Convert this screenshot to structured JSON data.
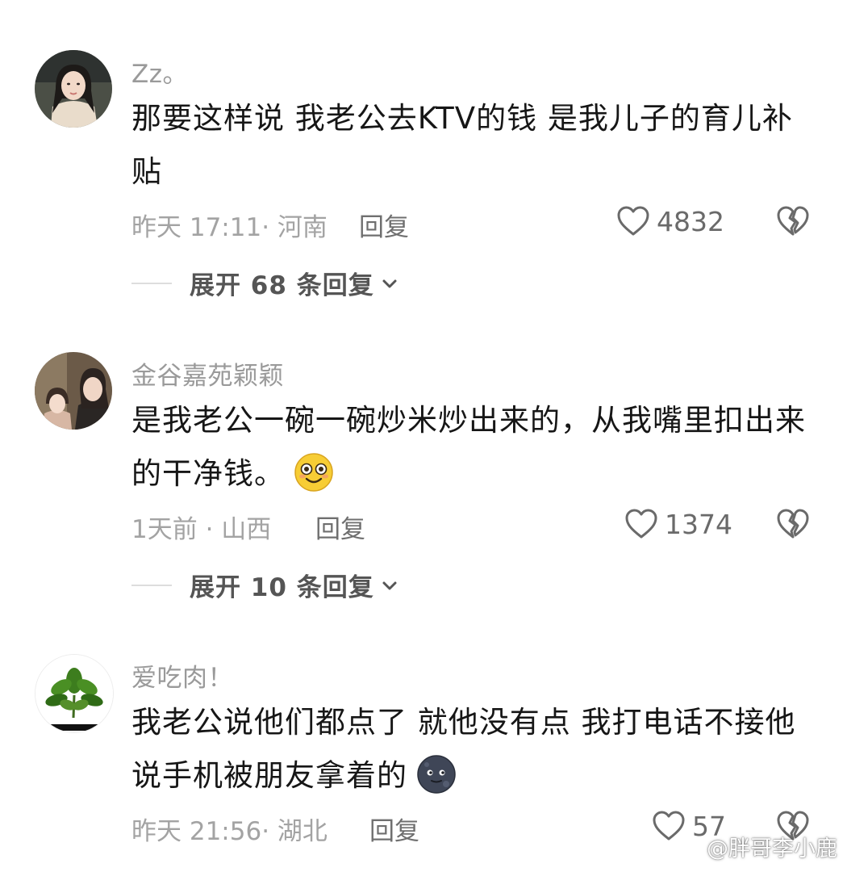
{
  "comments": [
    {
      "username": "Zz。",
      "text": "那要这样说 我老公去KTV的钱  是我儿子的育儿补贴",
      "time": "昨天 17:11",
      "location": "· 河南",
      "reply_label": "回复",
      "likes": "4832",
      "expand_label": "展开 68 条回复",
      "avatar_icon": "woman-portrait",
      "emoji_icon": null
    },
    {
      "username": "金谷嘉苑颖颖",
      "text": "是我老公一碗一碗炒米炒出来的，从我嘴里扣出来的干净钱。",
      "time": "1天前",
      "location": " · 山西",
      "reply_label": "回复",
      "likes": "1374",
      "expand_label": "展开 10 条回复",
      "avatar_icon": "mother-child-portrait",
      "emoji_icon": "smiling-face-emoji"
    },
    {
      "username": "爱吃肉！",
      "text": "我老公说他们都点了 就他没有点  我打电话不接他说手机被朋友拿着的",
      "time": "昨天 21:56",
      "location": "· 湖北",
      "reply_label": "回复",
      "likes": "57",
      "avatar_icon": "plant",
      "emoji_icon": "new-moon-face-emoji"
    }
  ],
  "watermark": {
    "text": "@胖哥李小鹿",
    "icon": "weibo-logo"
  },
  "colors": {
    "username": "#9a9a9a",
    "text": "#161616",
    "meta": "#a3a3a3",
    "icons": "#6a6a6a"
  }
}
